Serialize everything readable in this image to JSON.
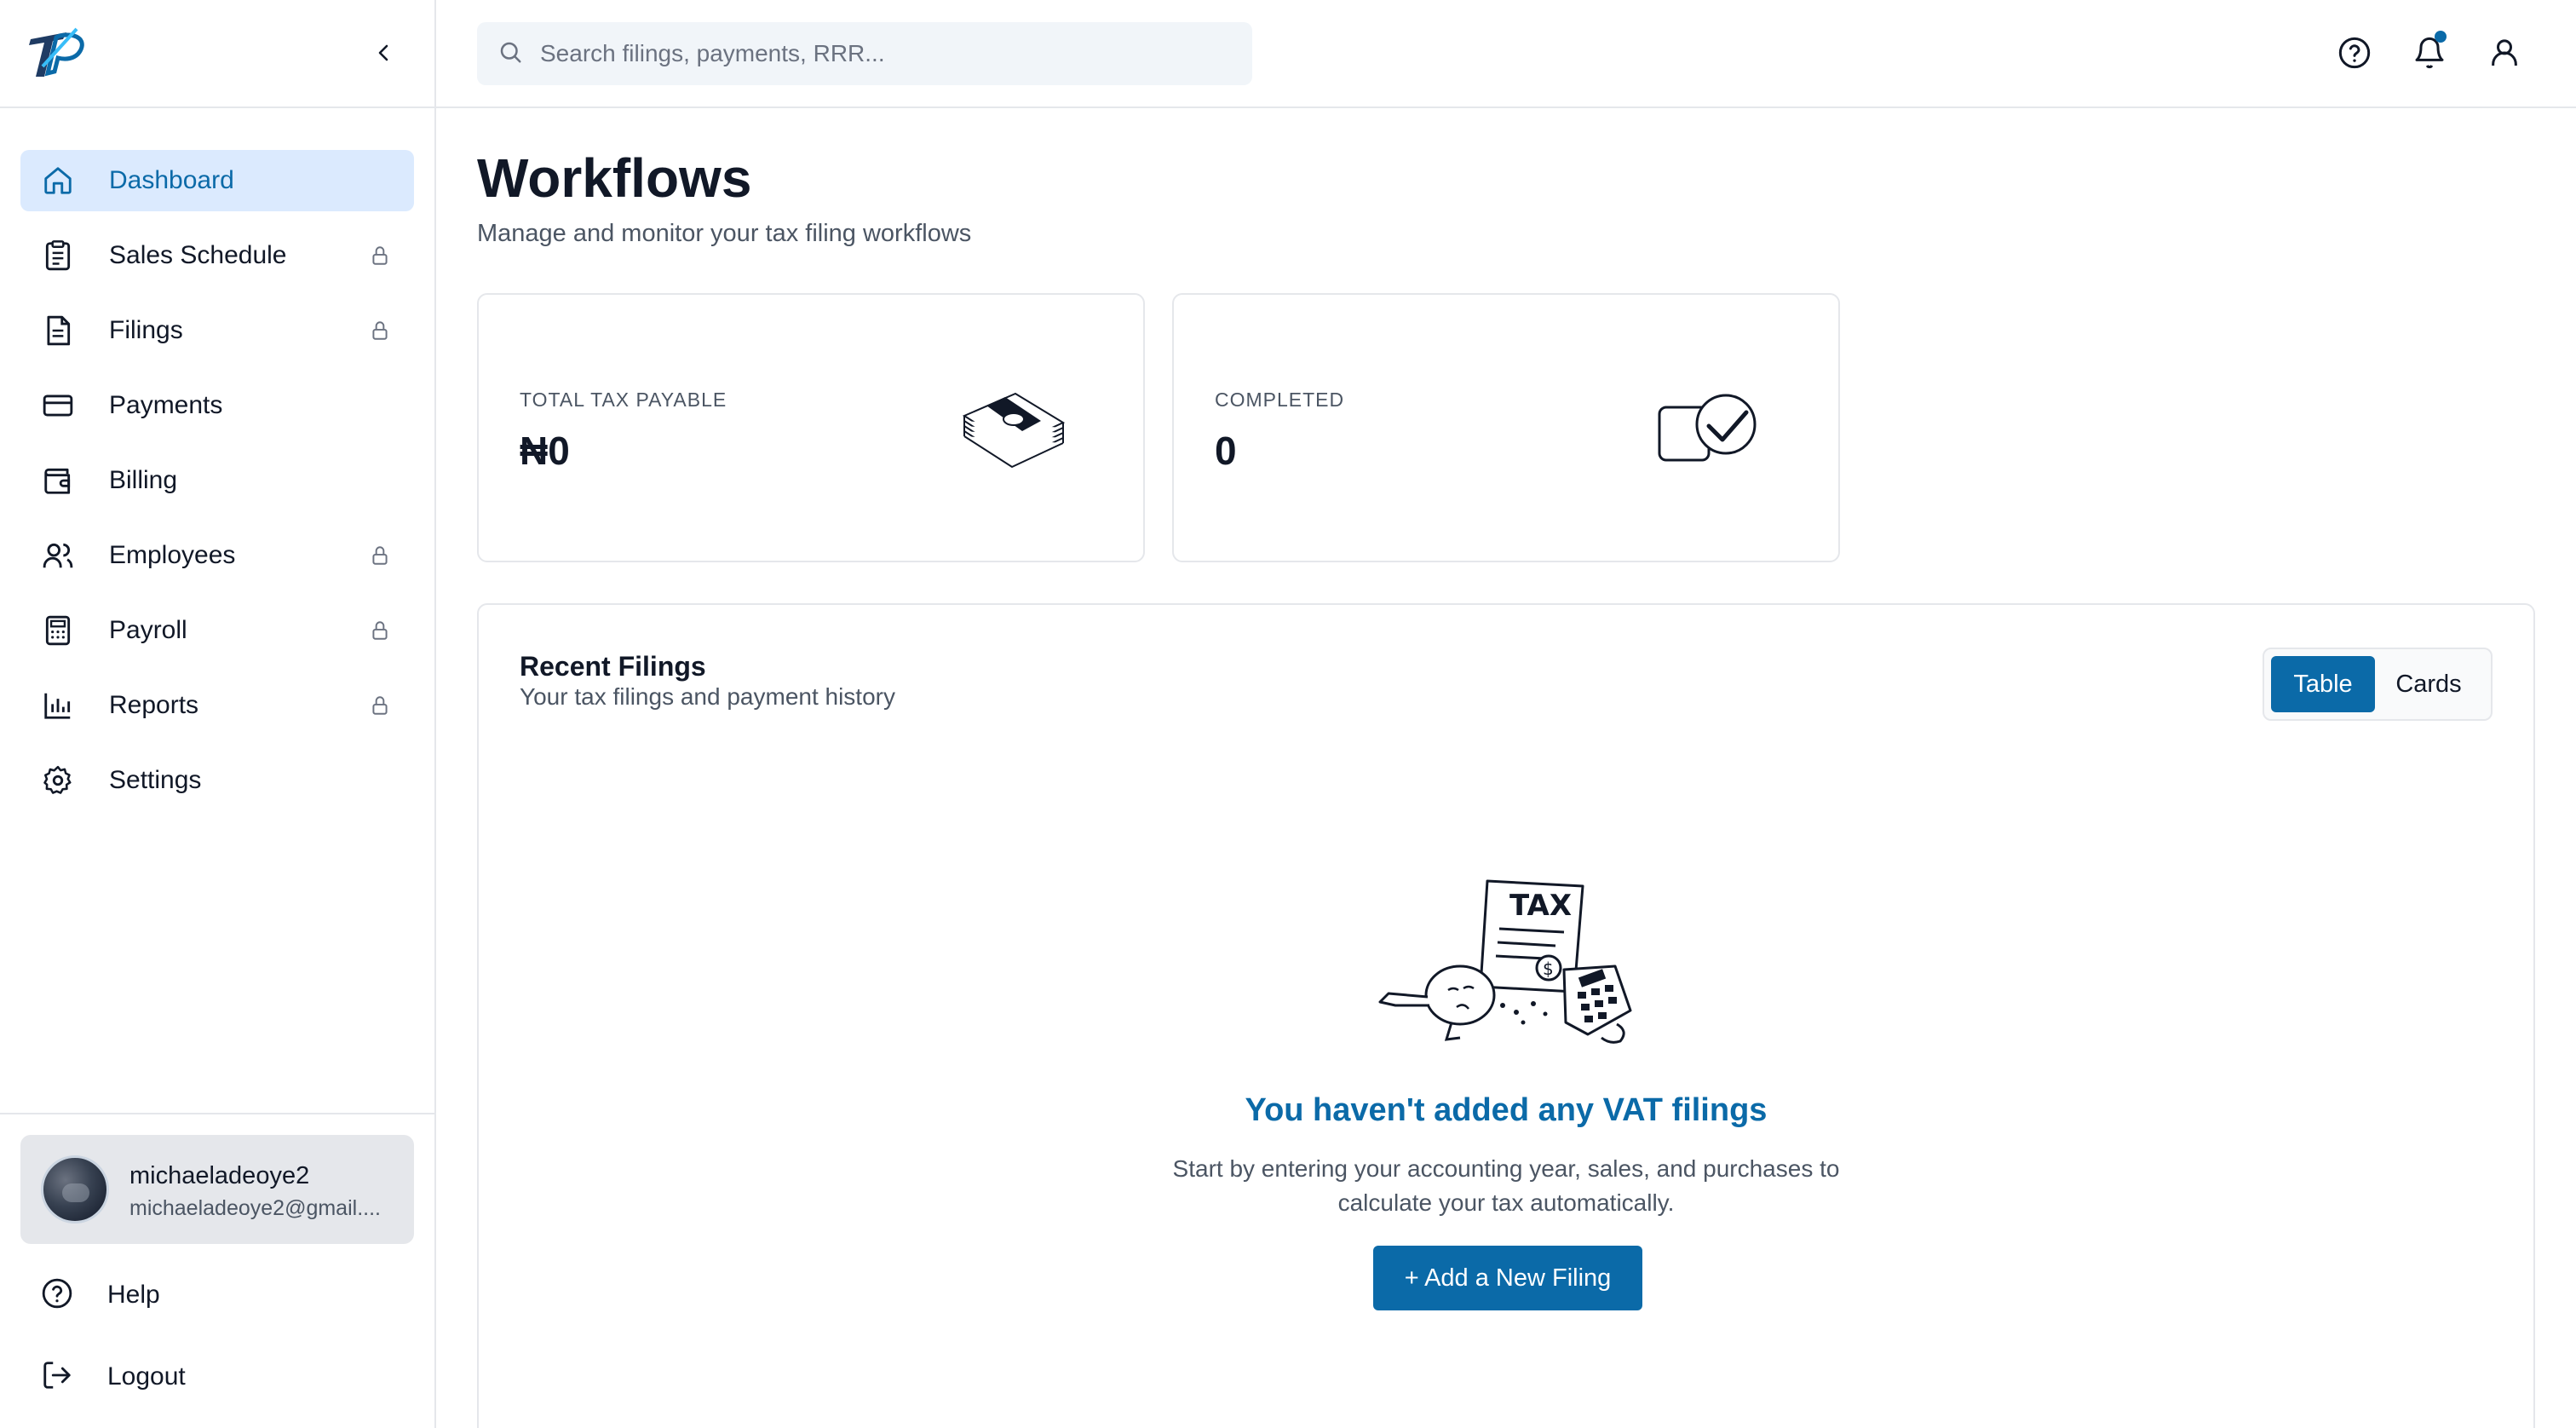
{
  "sidebar": {
    "items": [
      {
        "label": "Dashboard",
        "icon": "home-icon",
        "active": true,
        "locked": false
      },
      {
        "label": "Sales Schedule",
        "icon": "clipboard-icon",
        "active": false,
        "locked": true
      },
      {
        "label": "Filings",
        "icon": "document-icon",
        "active": false,
        "locked": true
      },
      {
        "label": "Payments",
        "icon": "credit-card-icon",
        "active": false,
        "locked": false
      },
      {
        "label": "Billing",
        "icon": "wallet-icon",
        "active": false,
        "locked": false
      },
      {
        "label": "Employees",
        "icon": "users-icon",
        "active": false,
        "locked": true
      },
      {
        "label": "Payroll",
        "icon": "calculator-icon",
        "active": false,
        "locked": true
      },
      {
        "label": "Reports",
        "icon": "bar-chart-icon",
        "active": false,
        "locked": true
      },
      {
        "label": "Settings",
        "icon": "gear-icon",
        "active": false,
        "locked": false
      }
    ],
    "user": {
      "name": "michaeladeoye2",
      "email": "michaeladeoye2@gmail...."
    },
    "help_label": "Help",
    "logout_label": "Logout"
  },
  "topbar": {
    "search_placeholder": "Search filings, payments, RRR..."
  },
  "main": {
    "title": "Workflows",
    "subtitle": "Manage and monitor your tax filing workflows",
    "stats": [
      {
        "label": "TOTAL TAX PAYABLE",
        "value": "₦0"
      },
      {
        "label": "COMPLETED",
        "value": "0"
      }
    ],
    "recent": {
      "title": "Recent Filings",
      "subtitle": "Your tax filings and payment history",
      "view_table": "Table",
      "view_cards": "Cards",
      "empty_title": "You haven't added any VAT filings",
      "empty_desc_line1": "Start by entering your accounting year, sales, and purchases to",
      "empty_desc_line2": "calculate your tax automatically.",
      "add_button": "+ Add a New Filing",
      "illustration_text": "TAX"
    }
  },
  "colors": {
    "accent": "#0b6aa8",
    "active_bg": "#dbeafe",
    "border": "#e5e7eb"
  }
}
